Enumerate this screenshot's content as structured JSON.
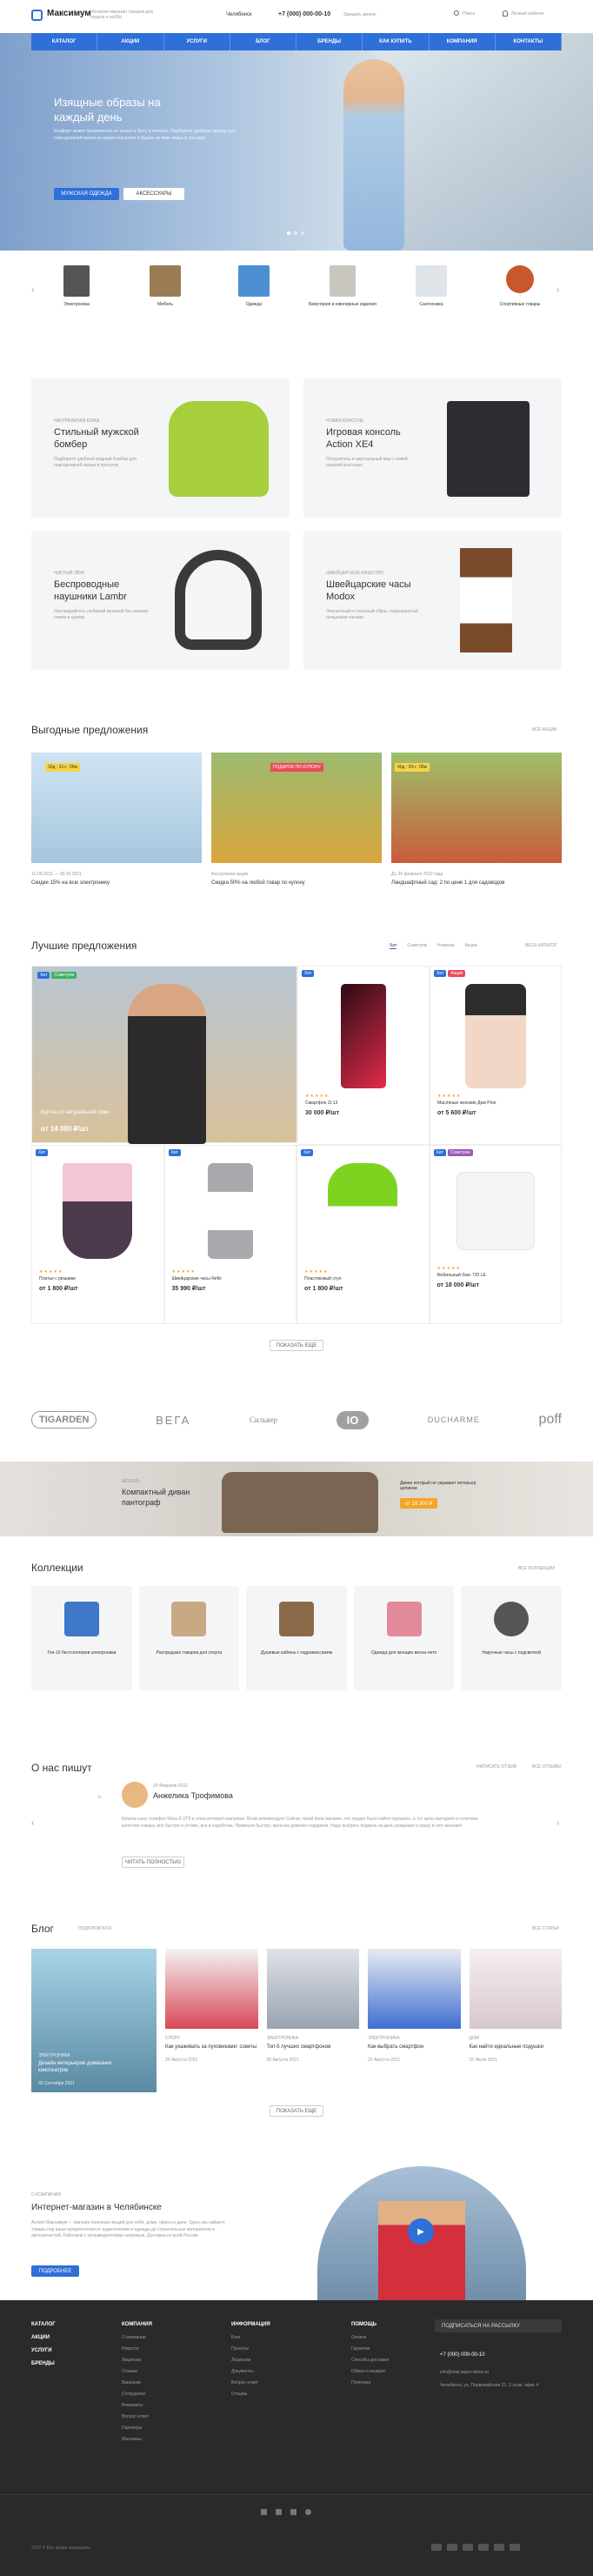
{
  "header": {
    "brand": "Максимум",
    "tagline": "Интернет-магазин товаров для отдыха и хобби",
    "city": "Челябинск",
    "phone": "+7 (000) 000-00-10",
    "callback": "Заказать звонок",
    "search": "Поиск",
    "account": "Личный кабинет"
  },
  "nav": [
    "КАТАЛОГ",
    "АКЦИИ",
    "УСЛУГИ",
    "БЛОГ",
    "БРЕНДЫ",
    "КАК КУПИТЬ",
    "КОМПАНИЯ",
    "КОНТАКТЫ"
  ],
  "hero": {
    "title": "Изящные образы на каждый день",
    "text": "Конфорт может проявляться не только в быту и платьях. Подберите удобную одежду для повседневной жизни из нашего каталога и будьте на пике модных трендов",
    "primary": "МУЖСКАЯ ОДЕЖДА",
    "secondary": "АКСЕССУАРЫ"
  },
  "categories": [
    "Электроника",
    "Мебель",
    "Одежда",
    "Бижутерия и ювелирные изделия",
    "Сантехника",
    "Спортивные товары"
  ],
  "promos": [
    {
      "eyebrow": "НАТУРАЛЬНАЯ КОЖА",
      "title": "Стильный мужской бомбер",
      "text": "Подберите удобный модный бомбер для повседневной жизни и прогулок"
    },
    {
      "eyebrow": "НОВАЯ КОНСОЛЬ",
      "title": "Игровая консоль Action XE4",
      "text": "Погрузитесь в виртуальный мир с новой игровой консолью"
    },
    {
      "eyebrow": "ЧИСТЫЙ ЗВУК",
      "title": "Беспроводные наушники Lambr",
      "text": "Наслаждайтесь любимой музыкой без лишних помех и шумов"
    },
    {
      "eyebrow": "ШВЕЙЦАРСКОЕ КАЧЕСТВО",
      "title": "Швейцарские часы Modox",
      "text": "Элегантный и стильный образ, подчеркнутый изящными часами"
    }
  ],
  "offers": {
    "title": "Выгодные предложения",
    "all": "ВСЕ АКЦИИ",
    "items": [
      {
        "meta": "10.09.2021 — 30.10.2021",
        "text": "Скидки 15% на всю электронику",
        "timer": "30д : 21ч : 05м"
      },
      {
        "meta": "Бессрочная акция",
        "text": "Скидка 50% на любой товар по купону",
        "timer": "ПОДАРОК ПО КУПОНУ"
      },
      {
        "meta": "До 30 февраля 2022 года",
        "text": "Ландшафтный сад: 2 по цене 1 для садоводов",
        "timer": "40д : 20ч : 05м"
      }
    ]
  },
  "best": {
    "title": "Лучшие предложения",
    "tabs": [
      "Хит",
      "Советуем",
      "Новинки",
      "Акции"
    ],
    "all": "ВЕСЬ КАТАЛОГ",
    "featured": {
      "name": "Куртка из натуральной кожи",
      "price": "от 14 000 ₽/шт"
    },
    "items": [
      {
        "name": "Смартфон Zt 13",
        "price": "30 000 ₽/шт"
      },
      {
        "name": "Масляные женские Дом Prior",
        "price": "от 5 600 ₽/шт"
      },
      {
        "name": "Платье с рюшами",
        "price": "от 1 800 ₽/шт"
      },
      {
        "name": "Швейцарские часы Refix",
        "price": "35 990 ₽/шт"
      },
      {
        "name": "Пластиковый стул",
        "price": "от 1 800 ₽/шт"
      },
      {
        "name": "Мобильный бокс 720 LE",
        "price": "от 18 000 ₽/шт"
      }
    ],
    "more": "ПОКАЗАТЬ ЕЩЕ"
  },
  "brands": [
    "TIGARDEN",
    "ВЕГА",
    "Сильвер",
    "IO",
    "DUCHARME",
    "poff"
  ],
  "banner": {
    "eyebrow": "МЕБЕЛЬ",
    "title": "Компактный диван пантограф",
    "text": "Диван который не укрывает интерьер целиком",
    "price": "от 18 300 ₽"
  },
  "collections": {
    "title": "Коллекции",
    "all": "ВСЕ КОЛЛЕКЦИИ",
    "items": [
      "Топ-10 бестселлеров электроники",
      "Распродажа товаров для спорта",
      "Душевые кабины с гидромассажем",
      "Одежда для женщин весна-лето",
      "Наручные часы с подсветкой"
    ]
  },
  "reviews": {
    "title": "О нас пишут",
    "write": "НАПИСАТЬ ОТЗЫВ",
    "all": "ВСЕ ОТЗЫВЫ",
    "date": "20 Февраля 2022",
    "name": "Анжелика Трофимова",
    "text": "Купила сыну телефон Nova 8 UTS в этом интернет-магазине. Всем рекомендую! Сейчас такой done магазин, что трудно было найти хорошего, а тут цены выгоднее и отличное качество товара, всё быстро и учтиво, все в коробочке. Привезли быстро, мальчик доволен подарком. Надо выбрать подарок на день рождения и сразу в этот магазин!",
    "more": "ЧИТАТЬ ПОЛНОСТЬЮ"
  },
  "blog": {
    "title": "Блог",
    "sub": "ПОДПИСАТЬСЯ",
    "all": "ВСЕ СТАТЬИ",
    "items": [
      {
        "cat": "ЭЛЕКТРОНИКА",
        "title": "Дизайн интерьеров домашних кинотеатров",
        "date": "30 Сентября 2021"
      },
      {
        "cat": "СПОРТ",
        "title": "Как ухаживать за пуховиками: советы",
        "date": "20 Августа 2021"
      },
      {
        "cat": "ЭЛЕКТРОНИКА",
        "title": "Топ-5 лучших смартфонов",
        "date": "30 Августа 2021"
      },
      {
        "cat": "ЭЛЕКТРОНИКА",
        "title": "Как выбрать смартфон",
        "date": "20 Августа 2021"
      },
      {
        "cat": "ДОМ",
        "title": "Как найти идеальные подушки",
        "date": "15 Июля 2021"
      }
    ],
    "more": "ПОКАЗАТЬ ЕЩЕ"
  },
  "about": {
    "eyebrow": "О КОМПАНИИ",
    "title": "Интернет-магазин в Челябинске",
    "text": "Аспект Максимум — магазин полезных вещей для себя, дома, офиса и дачи. Здесь вы найдете товары под ваши предпочтения от аудиотехники и одежды до строительных материалов и автозапчастей. Работаем с производителями напрямую. Доставка по всей России.",
    "button": "ПОДРОБНЕЕ"
  },
  "footer": {
    "col1": [
      "КАТАЛОГ",
      "АКЦИИ",
      "УСЛУГИ",
      "БРЕНДЫ"
    ],
    "col2h": "КОМПАНИЯ",
    "col2": [
      "О компании",
      "Новости",
      "Лицензии",
      "Отзывы",
      "Вакансии",
      "Сотрудники",
      "Реквизиты",
      "Вопрос-ответ",
      "Партнеры",
      "Магазины"
    ],
    "col3h": "ИНФОРМАЦИЯ",
    "col3": [
      "Блог",
      "Проекты",
      "Лицензии",
      "Документы",
      "Вопрос-ответ",
      "Отзывы"
    ],
    "col4h": "ПОМОЩЬ",
    "col4": [
      "Оплата",
      "Гарантия",
      "Способы доставки",
      "Обмен и возврат",
      "Политика"
    ],
    "subscribe": "ПОДПИСАТЬСЯ НА РАССЫЛКУ",
    "phone": "+7 (000) 000-00-10",
    "email": "info@mail.aspro-demo.ru",
    "address": "Челябинск, ул. Первомайская 21, 3 этаж, офис 4",
    "copyright": "2022 © Все права защищены"
  }
}
